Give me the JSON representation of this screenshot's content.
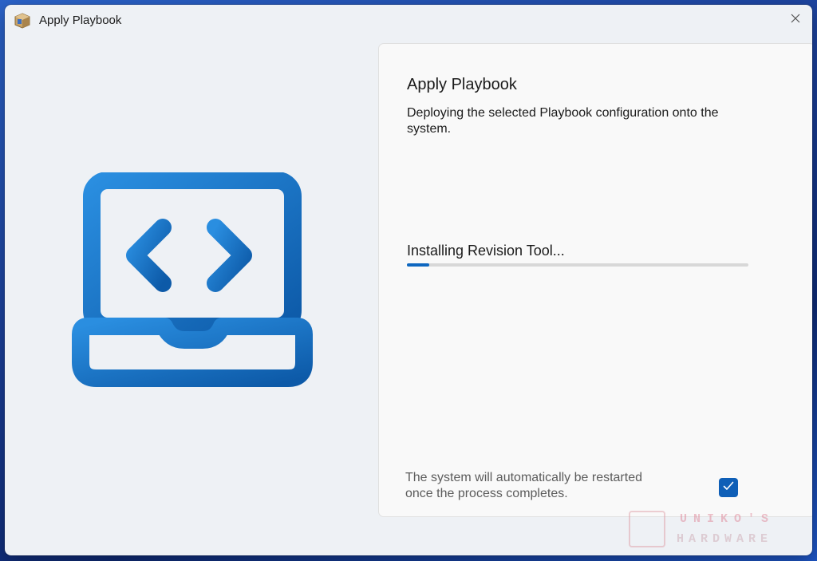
{
  "window": {
    "title": "Apply Playbook",
    "app_icon": "package-box-icon",
    "close_icon": "close-icon"
  },
  "illustration": {
    "icon": "laptop-code-icon",
    "color": "#1a73c7"
  },
  "card": {
    "title": "Apply Playbook",
    "description": "Deploying the selected Playbook configuration onto the system.",
    "status": "Installing Revision Tool...",
    "progress_fraction": 0.065,
    "accent_color": "#0e67c0",
    "note": "The system will automatically be restarted once the process completes.",
    "restart_checked": true
  },
  "watermark": {
    "line1": "UNIKO'S",
    "line2": "HARDWARE"
  }
}
